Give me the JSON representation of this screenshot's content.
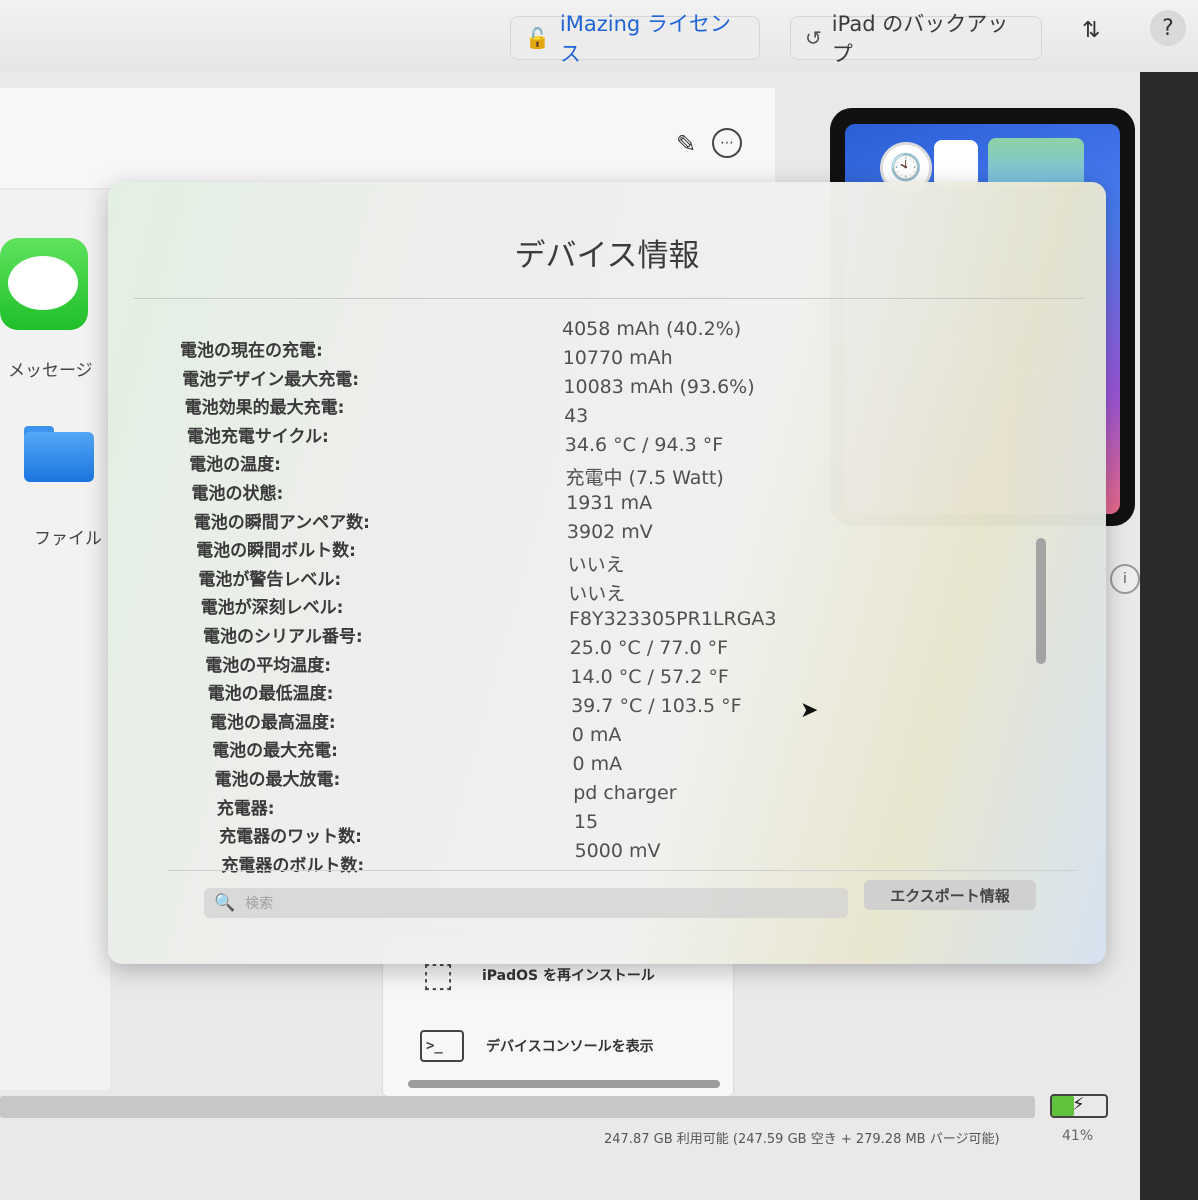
{
  "toolbar": {
    "license_label": "iMazing ライセンス",
    "backup_label": "iPad のバックアップ",
    "help_label": "?"
  },
  "sidebar": {
    "items": [
      {
        "label": "メッセージ"
      },
      {
        "label": "ファイル"
      }
    ]
  },
  "popover": {
    "title": "デバイス情報",
    "rows": [
      {
        "label": "電池の現在の充電:",
        "value": "4058 mAh (40.2%)"
      },
      {
        "label": "電池デザイン最大充電:",
        "value": "10770 mAh"
      },
      {
        "label": "電池効果的最大充電:",
        "value": "10083 mAh (93.6%)"
      },
      {
        "label": "電池充電サイクル:",
        "value": "43"
      },
      {
        "label": "電池の温度:",
        "value": "34.6 °C / 94.3 °F"
      },
      {
        "label": "電池の状態:",
        "value": "充電中 (7.5 Watt)"
      },
      {
        "label": "電池の瞬間アンペア数:",
        "value": "1931 mA"
      },
      {
        "label": "電池の瞬間ボルト数:",
        "value": "3902 mV"
      },
      {
        "label": "電池が警告レベル:",
        "value": "いいえ"
      },
      {
        "label": "電池が深刻レベル:",
        "value": "いいえ"
      },
      {
        "label": "電池のシリアル番号:",
        "value": "F8Y323305PR1LRGA3"
      },
      {
        "label": "電池の平均温度:",
        "value": "25.0 °C / 77.0 °F"
      },
      {
        "label": "電池の最低温度:",
        "value": "14.0 °C / 57.2 °F"
      },
      {
        "label": "電池の最高温度:",
        "value": "39.7 °C / 103.5 °F"
      },
      {
        "label": "電池の最大充電:",
        "value": "0 mA"
      },
      {
        "label": "電池の最大放電:",
        "value": "0 mA"
      },
      {
        "label": "充電器:",
        "value": "pd charger"
      },
      {
        "label": "充電器のワット数:",
        "value": "15"
      },
      {
        "label": "充電器のボルト数:",
        "value": "5000 mV"
      }
    ],
    "search_placeholder": "検索",
    "export_label": "エクスポート情報"
  },
  "actions": {
    "reinstall_label": "iPadOS を再インストール",
    "console_label": "デバイスコンソールを表示"
  },
  "status": {
    "storage_text": "247.87 GB 利用可能 (247.59 GB 空き + 279.28 MB パージ可能)",
    "battery_percent": "41%",
    "battery_level": 0.41
  }
}
